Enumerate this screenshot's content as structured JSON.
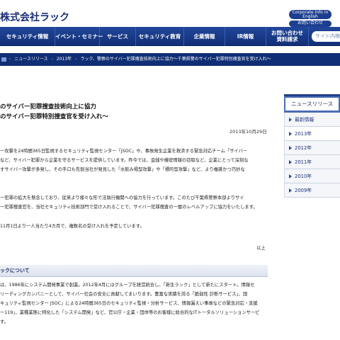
{
  "header": {
    "logo": "株式会社ラック",
    "corporate_info": "Corporate Info\nin English",
    "contact": "お問い合わせ"
  },
  "nav": {
    "items": [
      {
        "label": "セキュリティ情報"
      },
      {
        "label": "イベント・セミナー"
      },
      {
        "label": "サービス"
      },
      {
        "label": "セキュリティ教育"
      },
      {
        "label": "企業情報"
      },
      {
        "label": "IR情報"
      },
      {
        "label": "お問い合わせ\n資料請求"
      }
    ],
    "search_placeholder": "サイト内検索"
  },
  "breadcrumb": {
    "items": [
      "ニュースリリース",
      "2013年",
      "ラック、警察のサイバー犯罪捜査技術向上に協力～千葉県警のサイバー犯罪特別捜査官を受け入れ～"
    ]
  },
  "article": {
    "title_line1": "のサイバー犯罪捜査技術向上に協力",
    "title_line2": "のサイバー犯罪特別捜査官を受け入れ～",
    "date": "2013年10月29日",
    "para1": [
      "ー攻撃を24時間365日監視するセキュリティ監視センター「JSOC」や、事故発生企業を救済する緊急対応チーム「サイバー",
      "など、サイバー犯罪から企業を守るサービスを提供しています。昨今では、金銭や機密情報の窃取など、企業にとって深刻な",
      "すサイバー攻撃が多発し、その手口も先鋭当社が発見した「水飲み場型攻撃」や「標的型攻撃」など、より複雑かつ巧妙な"
    ],
    "para2": [
      "ー犯罪の拡大を懸念しており、従来より様々な形で法執行機関への協力を行っています。このたび千葉県警察本部よりサイ",
      "ー犯罪捜査官を、当社セキュリティ技術部門で受け入れることで、サイバー犯罪捜査の一層のレベルアップに協力をいたします。"
    ],
    "para3": [
      "11月1日より一人当たり4カ月で、複数名の受け入れを予定しています。"
    ],
    "closing": "以上",
    "about_heading": "ックについて",
    "about_para": [
      "は、1986年にシステム開発事業で創業。2012年4月にはグループを経営統合し、「新生ラック」として新たにスタート。情報セ",
      "リーディングカンパニーとして、サイバー社会の安全に貢献してまいります。豊富な実績を誇る「脆弱性 診断サービス」、国",
      "キュリティ監視センター JSOC」による24時間365日のセキュリティ監視・分析サービス、情報漏えい事故などの緊急対応・支援",
      "ー119」、業種業態に特化した「システム開発」など、官公庁・企業・団体等のお客様に総合的なITトータルソリューションサービ",
      "す。"
    ]
  },
  "sidebar": {
    "title": "ニュースリリース",
    "items": [
      {
        "label": "最新情報"
      },
      {
        "label": "2013年"
      },
      {
        "label": "2012年"
      },
      {
        "label": "2011年"
      },
      {
        "label": "2010年"
      },
      {
        "label": "2009年"
      }
    ]
  }
}
